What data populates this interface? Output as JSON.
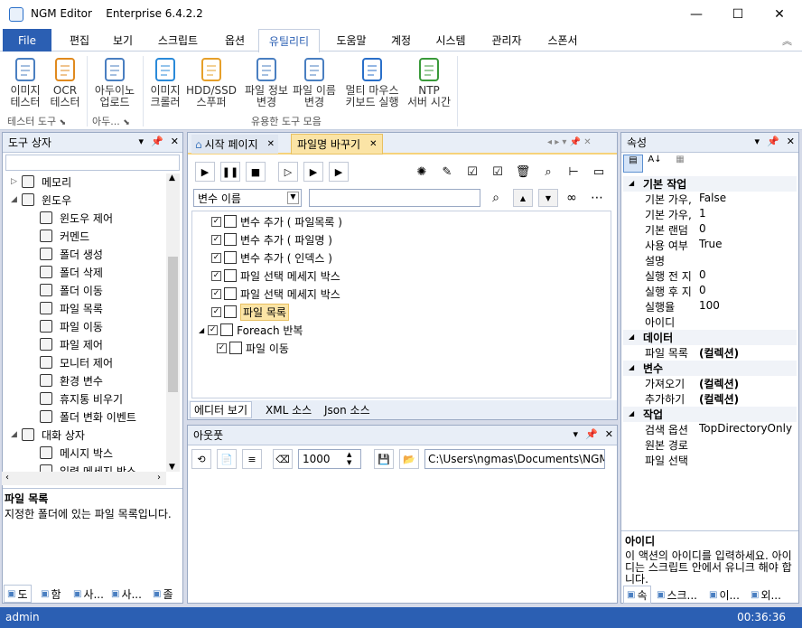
{
  "app": {
    "name": "NGM Editor",
    "edition": "Enterprise 6.4.2.2"
  },
  "window": {
    "minimize": "—",
    "maximize": "☐",
    "close": "✕"
  },
  "menu": {
    "file": "File",
    "tabs": [
      "편집",
      "보기",
      "스크립트",
      "옵션",
      "유틸리티",
      "도움말",
      "계정",
      "시스템",
      "관리자",
      "스폰서"
    ]
  },
  "ribbon": {
    "buttons": [
      {
        "l1": "이미지",
        "l2": "테스터",
        "icon": "image-tester-icon",
        "color": "#4a7fc1"
      },
      {
        "l1": "OCR",
        "l2": "테스터",
        "icon": "ocr-tester-icon",
        "color": "#e08a1e"
      },
      {
        "l1": "아두이노",
        "l2": "업로드",
        "icon": "arduino-upload-icon",
        "color": "#4a7fc1"
      },
      {
        "l1": "이미지",
        "l2": "크롤러",
        "icon": "image-crawler-icon",
        "color": "#2a8ad9"
      },
      {
        "l1": "HDD/SSD",
        "l2": "스푸퍼",
        "icon": "hdd-spoofer-icon",
        "color": "#e6a02a"
      },
      {
        "l1": "파일 정보",
        "l2": "변경",
        "icon": "file-info-icon",
        "color": "#4a7fc1"
      },
      {
        "l1": "파일 이름",
        "l2": "변경",
        "icon": "file-rename-icon",
        "color": "#4a7fc1"
      },
      {
        "l1": "멀티 마우스",
        "l2": "키보드 실행",
        "icon": "multi-mouse-icon",
        "color": "#2a6fc9"
      },
      {
        "l1": "NTP",
        "l2": "서버 시간",
        "icon": "ntp-server-icon",
        "color": "#3a9a3a"
      }
    ],
    "groups": [
      "테스터 도구",
      "아두...",
      "유용한 도구 모음"
    ]
  },
  "toolbox": {
    "title": "도구 상자",
    "items": [
      {
        "label": "메모리",
        "level": 0,
        "expand": "▷"
      },
      {
        "label": "윈도우",
        "level": 0,
        "expand": "◢"
      },
      {
        "label": "윈도우 제어",
        "level": 1
      },
      {
        "label": "커멘드",
        "level": 1
      },
      {
        "label": "폴더 생성",
        "level": 1
      },
      {
        "label": "폴더 삭제",
        "level": 1
      },
      {
        "label": "폴더 이동",
        "level": 1
      },
      {
        "label": "파일 목록",
        "level": 1
      },
      {
        "label": "파일 이동",
        "level": 1
      },
      {
        "label": "파일 제어",
        "level": 1
      },
      {
        "label": "모니터 제어",
        "level": 1
      },
      {
        "label": "환경 변수",
        "level": 1
      },
      {
        "label": "휴지통 비우기",
        "level": 1
      },
      {
        "label": "폴더 변화 이벤트",
        "level": 1
      },
      {
        "label": "대화 상자",
        "level": 0,
        "expand": "◢"
      },
      {
        "label": "메시지 박스",
        "level": 1
      },
      {
        "label": "입력 메세지 박스",
        "level": 1
      }
    ],
    "desc_title": "파일 목록",
    "desc_text": "지정한 폴더에 있는 파일 목록입니다.",
    "bottom_tabs": [
      "도",
      "함",
      "사...",
      "사...",
      "졸"
    ]
  },
  "editor": {
    "tabs": [
      "시작 페이지",
      "파일명 바꾸기"
    ],
    "search_combo": "변수 이름",
    "search_value": "",
    "tree": [
      {
        "label": "변수 추가 ( 파일목록 )",
        "level": 0,
        "selected": false
      },
      {
        "label": "변수 추가 ( 파일명 )",
        "level": 0,
        "selected": false
      },
      {
        "label": "변수 추가 ( 인덱스 )",
        "level": 0,
        "selected": false
      },
      {
        "label": "파일 선택 메세지 박스",
        "level": 0,
        "selected": false
      },
      {
        "label": "파일 선택 메세지 박스",
        "level": 0,
        "selected": false
      },
      {
        "label": "파일 목록",
        "level": 0,
        "selected": true
      },
      {
        "label": "Foreach 반복",
        "level": 0,
        "selected": false
      },
      {
        "label": "파일 이동",
        "level": 1,
        "selected": false
      }
    ],
    "bottom_tabs": [
      "에디터 보기",
      "XML 소스",
      "Json 소스"
    ]
  },
  "output": {
    "title": "아웃풋",
    "count": "1000",
    "path": "C:\\Users\\ngmas\\Documents\\NGM6\\"
  },
  "properties": {
    "title": "속성",
    "sections": [
      {
        "name": "기본 작업",
        "rows": [
          [
            "기본 가우,",
            "False"
          ],
          [
            "기본 가우,",
            "1"
          ],
          [
            "기본 랜덤",
            "0"
          ],
          [
            "사용 여부",
            "True"
          ],
          [
            "설명",
            ""
          ],
          [
            "실행 전 지",
            "0"
          ],
          [
            "실행 후 지",
            "0"
          ],
          [
            "실행율",
            "100"
          ],
          [
            "아이디",
            ""
          ]
        ]
      },
      {
        "name": "데이터",
        "rows": [
          [
            "파일 목록",
            "(컬렉션)"
          ]
        ]
      },
      {
        "name": "변수",
        "rows": [
          [
            "가져오기",
            "(컬렉션)"
          ],
          [
            "추가하기",
            "(컬렉션)"
          ]
        ]
      },
      {
        "name": "작업",
        "rows": [
          [
            "검색 옵션",
            "TopDirectoryOnly"
          ],
          [
            "원본 경로",
            ""
          ],
          [
            "파일 선택",
            ""
          ]
        ]
      }
    ],
    "desc_title": "아이디",
    "desc_text": "이 액션의 아이디를 입력하세요. 아이디는 스크립트 안에서 유니크 해야 합니다.",
    "bottom_tabs": [
      "속",
      "스크...",
      "이...",
      "외..."
    ]
  },
  "status": {
    "user": "admin",
    "time": "00:36:36"
  }
}
